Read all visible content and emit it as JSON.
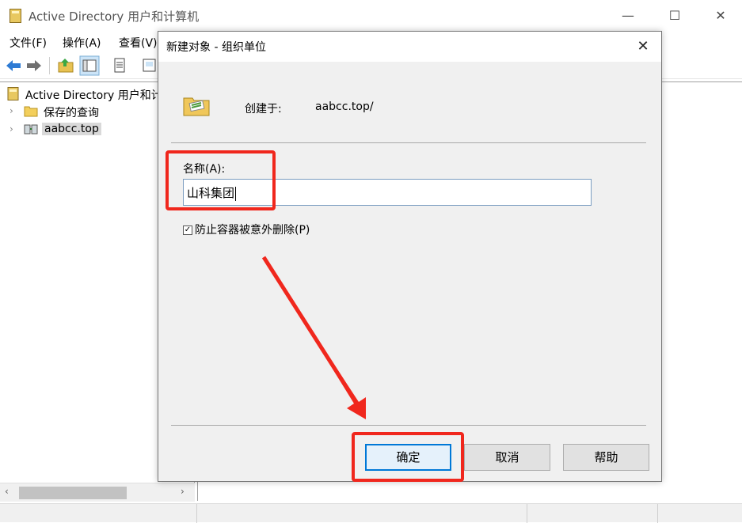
{
  "window": {
    "title": "Active Directory 用户和计算机",
    "icon": "directory-book-icon",
    "min_glyph": "—",
    "max_glyph": "☐",
    "close_glyph": "✕"
  },
  "menu": {
    "file": "文件(F)",
    "action": "操作(A)",
    "view": "查看(V)"
  },
  "tree": {
    "root": "Active Directory 用户和计",
    "saved_queries": "保存的查询",
    "domain": "aabcc.top",
    "chevron": "›"
  },
  "scrollbar": {
    "left_glyph": "‹",
    "right_glyph": "›"
  },
  "dialog": {
    "title": "新建对象 - 组织单位",
    "close_glyph": "✕",
    "created_in_label": "创建于:",
    "created_in_value": "aabcc.top/",
    "name_label": "名称(A):",
    "name_value": "山科集团",
    "protect_label": "防止容器被意外删除(P)",
    "protect_checked": true,
    "ok": "确定",
    "cancel": "取消",
    "help": "帮助"
  },
  "colors": {
    "annotation_red": "#f0271d",
    "focus_blue": "#0078d7",
    "dialog_bg": "#f0f0f0"
  }
}
